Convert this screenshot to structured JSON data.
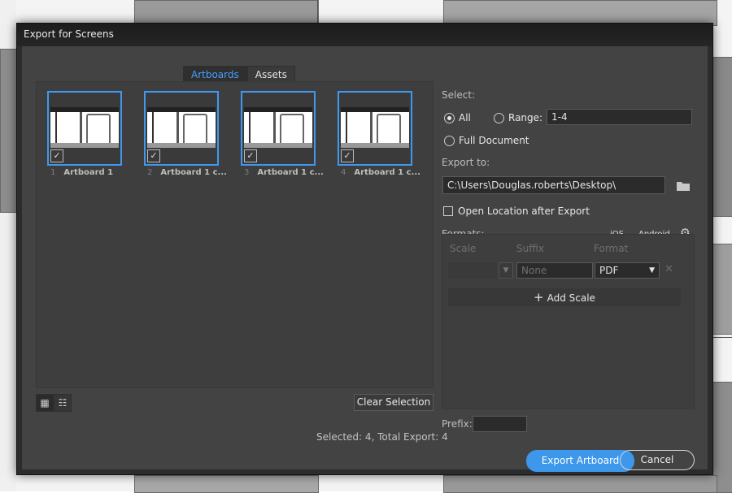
{
  "dialog": {
    "title": "Export for Screens",
    "tabs": [
      {
        "label": "Artboards",
        "active": true
      },
      {
        "label": "Assets",
        "active": false
      }
    ]
  },
  "artboards": [
    {
      "number": "1",
      "name": "Artboard 1",
      "checked": true
    },
    {
      "number": "2",
      "name": "Artboard 1 c...",
      "checked": true
    },
    {
      "number": "3",
      "name": "Artboard 1 c...",
      "checked": true
    },
    {
      "number": "4",
      "name": "Artboard 1 c...",
      "checked": true
    }
  ],
  "view_buttons": [
    {
      "icon": "grid-view-icon",
      "glyph": "▦",
      "active": true
    },
    {
      "icon": "list-view-icon",
      "glyph": "☷",
      "active": false
    }
  ],
  "clear_selection_label": "Clear Selection",
  "status_text": "Selected: 4, Total Export: 4",
  "select": {
    "label": "Select:",
    "all_label": "All",
    "range_label": "Range:",
    "range_value": "1-4",
    "full_document_label": "Full Document",
    "selected_option": "All"
  },
  "export_to": {
    "label": "Export to:",
    "path": "C:\\Users\\Douglas.roberts\\Desktop\\",
    "open_location_label": "Open Location after Export",
    "open_location_checked": false
  },
  "formats": {
    "label": "Formats:",
    "ios_label": "iOS",
    "android_label": "Android",
    "col_scale": "Scale",
    "col_suffix": "Suffix",
    "col_format": "Format",
    "suffix_placeholder": "None",
    "format_value": "PDF",
    "add_scale_label": "Add Scale"
  },
  "prefix": {
    "label": "Prefix:",
    "value": ""
  },
  "buttons": {
    "export_label": "Export Artboard",
    "cancel_label": "Cancel"
  },
  "colors": {
    "accent": "#3d97ea",
    "dialog_bg": "#434343",
    "selection_border": "#3f98f2"
  }
}
